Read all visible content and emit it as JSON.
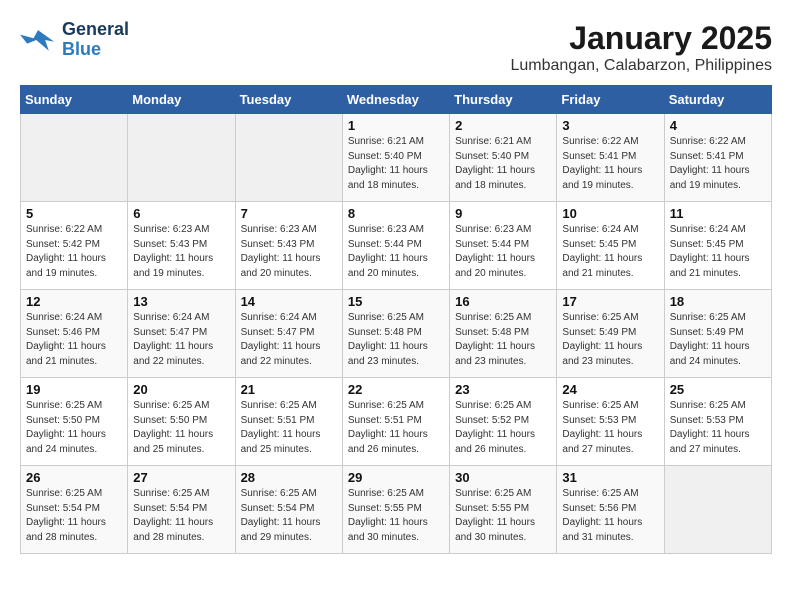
{
  "logo": {
    "line1": "General",
    "line2": "Blue"
  },
  "title": "January 2025",
  "subtitle": "Lumbangan, Calabarzon, Philippines",
  "days_of_week": [
    "Sunday",
    "Monday",
    "Tuesday",
    "Wednesday",
    "Thursday",
    "Friday",
    "Saturday"
  ],
  "weeks": [
    [
      {
        "day": "",
        "sunrise": "",
        "sunset": "",
        "daylight": ""
      },
      {
        "day": "",
        "sunrise": "",
        "sunset": "",
        "daylight": ""
      },
      {
        "day": "",
        "sunrise": "",
        "sunset": "",
        "daylight": ""
      },
      {
        "day": "1",
        "sunrise": "Sunrise: 6:21 AM",
        "sunset": "Sunset: 5:40 PM",
        "daylight": "Daylight: 11 hours and 18 minutes."
      },
      {
        "day": "2",
        "sunrise": "Sunrise: 6:21 AM",
        "sunset": "Sunset: 5:40 PM",
        "daylight": "Daylight: 11 hours and 18 minutes."
      },
      {
        "day": "3",
        "sunrise": "Sunrise: 6:22 AM",
        "sunset": "Sunset: 5:41 PM",
        "daylight": "Daylight: 11 hours and 19 minutes."
      },
      {
        "day": "4",
        "sunrise": "Sunrise: 6:22 AM",
        "sunset": "Sunset: 5:41 PM",
        "daylight": "Daylight: 11 hours and 19 minutes."
      }
    ],
    [
      {
        "day": "5",
        "sunrise": "Sunrise: 6:22 AM",
        "sunset": "Sunset: 5:42 PM",
        "daylight": "Daylight: 11 hours and 19 minutes."
      },
      {
        "day": "6",
        "sunrise": "Sunrise: 6:23 AM",
        "sunset": "Sunset: 5:43 PM",
        "daylight": "Daylight: 11 hours and 19 minutes."
      },
      {
        "day": "7",
        "sunrise": "Sunrise: 6:23 AM",
        "sunset": "Sunset: 5:43 PM",
        "daylight": "Daylight: 11 hours and 20 minutes."
      },
      {
        "day": "8",
        "sunrise": "Sunrise: 6:23 AM",
        "sunset": "Sunset: 5:44 PM",
        "daylight": "Daylight: 11 hours and 20 minutes."
      },
      {
        "day": "9",
        "sunrise": "Sunrise: 6:23 AM",
        "sunset": "Sunset: 5:44 PM",
        "daylight": "Daylight: 11 hours and 20 minutes."
      },
      {
        "day": "10",
        "sunrise": "Sunrise: 6:24 AM",
        "sunset": "Sunset: 5:45 PM",
        "daylight": "Daylight: 11 hours and 21 minutes."
      },
      {
        "day": "11",
        "sunrise": "Sunrise: 6:24 AM",
        "sunset": "Sunset: 5:45 PM",
        "daylight": "Daylight: 11 hours and 21 minutes."
      }
    ],
    [
      {
        "day": "12",
        "sunrise": "Sunrise: 6:24 AM",
        "sunset": "Sunset: 5:46 PM",
        "daylight": "Daylight: 11 hours and 21 minutes."
      },
      {
        "day": "13",
        "sunrise": "Sunrise: 6:24 AM",
        "sunset": "Sunset: 5:47 PM",
        "daylight": "Daylight: 11 hours and 22 minutes."
      },
      {
        "day": "14",
        "sunrise": "Sunrise: 6:24 AM",
        "sunset": "Sunset: 5:47 PM",
        "daylight": "Daylight: 11 hours and 22 minutes."
      },
      {
        "day": "15",
        "sunrise": "Sunrise: 6:25 AM",
        "sunset": "Sunset: 5:48 PM",
        "daylight": "Daylight: 11 hours and 23 minutes."
      },
      {
        "day": "16",
        "sunrise": "Sunrise: 6:25 AM",
        "sunset": "Sunset: 5:48 PM",
        "daylight": "Daylight: 11 hours and 23 minutes."
      },
      {
        "day": "17",
        "sunrise": "Sunrise: 6:25 AM",
        "sunset": "Sunset: 5:49 PM",
        "daylight": "Daylight: 11 hours and 23 minutes."
      },
      {
        "day": "18",
        "sunrise": "Sunrise: 6:25 AM",
        "sunset": "Sunset: 5:49 PM",
        "daylight": "Daylight: 11 hours and 24 minutes."
      }
    ],
    [
      {
        "day": "19",
        "sunrise": "Sunrise: 6:25 AM",
        "sunset": "Sunset: 5:50 PM",
        "daylight": "Daylight: 11 hours and 24 minutes."
      },
      {
        "day": "20",
        "sunrise": "Sunrise: 6:25 AM",
        "sunset": "Sunset: 5:50 PM",
        "daylight": "Daylight: 11 hours and 25 minutes."
      },
      {
        "day": "21",
        "sunrise": "Sunrise: 6:25 AM",
        "sunset": "Sunset: 5:51 PM",
        "daylight": "Daylight: 11 hours and 25 minutes."
      },
      {
        "day": "22",
        "sunrise": "Sunrise: 6:25 AM",
        "sunset": "Sunset: 5:51 PM",
        "daylight": "Daylight: 11 hours and 26 minutes."
      },
      {
        "day": "23",
        "sunrise": "Sunrise: 6:25 AM",
        "sunset": "Sunset: 5:52 PM",
        "daylight": "Daylight: 11 hours and 26 minutes."
      },
      {
        "day": "24",
        "sunrise": "Sunrise: 6:25 AM",
        "sunset": "Sunset: 5:53 PM",
        "daylight": "Daylight: 11 hours and 27 minutes."
      },
      {
        "day": "25",
        "sunrise": "Sunrise: 6:25 AM",
        "sunset": "Sunset: 5:53 PM",
        "daylight": "Daylight: 11 hours and 27 minutes."
      }
    ],
    [
      {
        "day": "26",
        "sunrise": "Sunrise: 6:25 AM",
        "sunset": "Sunset: 5:54 PM",
        "daylight": "Daylight: 11 hours and 28 minutes."
      },
      {
        "day": "27",
        "sunrise": "Sunrise: 6:25 AM",
        "sunset": "Sunset: 5:54 PM",
        "daylight": "Daylight: 11 hours and 28 minutes."
      },
      {
        "day": "28",
        "sunrise": "Sunrise: 6:25 AM",
        "sunset": "Sunset: 5:54 PM",
        "daylight": "Daylight: 11 hours and 29 minutes."
      },
      {
        "day": "29",
        "sunrise": "Sunrise: 6:25 AM",
        "sunset": "Sunset: 5:55 PM",
        "daylight": "Daylight: 11 hours and 30 minutes."
      },
      {
        "day": "30",
        "sunrise": "Sunrise: 6:25 AM",
        "sunset": "Sunset: 5:55 PM",
        "daylight": "Daylight: 11 hours and 30 minutes."
      },
      {
        "day": "31",
        "sunrise": "Sunrise: 6:25 AM",
        "sunset": "Sunset: 5:56 PM",
        "daylight": "Daylight: 11 hours and 31 minutes."
      },
      {
        "day": "",
        "sunrise": "",
        "sunset": "",
        "daylight": ""
      }
    ]
  ]
}
